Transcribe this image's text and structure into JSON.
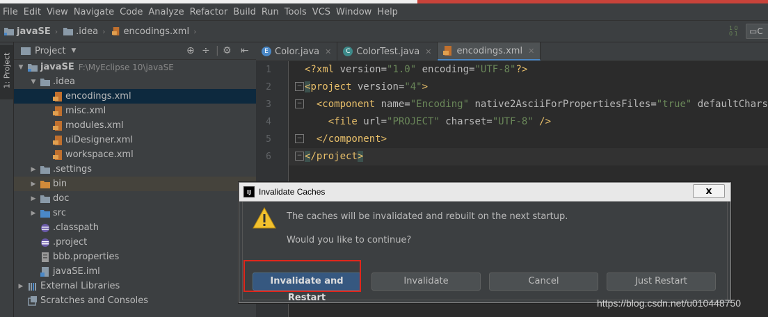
{
  "menu": [
    "File",
    "Edit",
    "View",
    "Navigate",
    "Code",
    "Analyze",
    "Refactor",
    "Build",
    "Run",
    "Tools",
    "VCS",
    "Window",
    "Help"
  ],
  "breadcrumb": [
    "javaSE",
    ".idea",
    "encodings.xml"
  ],
  "toolstrip_label": "1: Project",
  "project_panel": {
    "title": "Project",
    "tree": [
      {
        "label": "javaSE",
        "path": "F:\\MyEclipse 10\\javaSE",
        "icon": "module-folder-icon",
        "arrow": "open",
        "indent": 0
      },
      {
        "label": ".idea",
        "icon": "folder-icon",
        "arrow": "open",
        "indent": 1
      },
      {
        "label": "encodings.xml",
        "icon": "xml-file-icon",
        "arrow": "",
        "indent": 2,
        "selected": true
      },
      {
        "label": "misc.xml",
        "icon": "xml-file-icon",
        "arrow": "",
        "indent": 2
      },
      {
        "label": "modules.xml",
        "icon": "xml-file-icon",
        "arrow": "",
        "indent": 2
      },
      {
        "label": "uiDesigner.xml",
        "icon": "xml-file-icon",
        "arrow": "",
        "indent": 2
      },
      {
        "label": "workspace.xml",
        "icon": "xml-file-icon",
        "arrow": "",
        "indent": 2
      },
      {
        "label": ".settings",
        "icon": "folder-icon",
        "arrow": "closed",
        "indent": 1
      },
      {
        "label": "bin",
        "icon": "folder-orange-icon",
        "arrow": "closed",
        "indent": 1,
        "highlight": true
      },
      {
        "label": "doc",
        "icon": "folder-icon",
        "arrow": "closed",
        "indent": 1
      },
      {
        "label": "src",
        "icon": "folder-blue-icon",
        "arrow": "closed",
        "indent": 1
      },
      {
        "label": ".classpath",
        "icon": "eclipse-file-icon",
        "arrow": "",
        "indent": 1
      },
      {
        "label": ".project",
        "icon": "eclipse-file-icon",
        "arrow": "",
        "indent": 1
      },
      {
        "label": "bbb.properties",
        "icon": "properties-file-icon",
        "arrow": "",
        "indent": 1
      },
      {
        "label": "javaSE.iml",
        "icon": "iml-file-icon",
        "arrow": "",
        "indent": 1
      },
      {
        "label": "External Libraries",
        "icon": "library-icon",
        "arrow": "closed",
        "indent": 0
      },
      {
        "label": "Scratches and Consoles",
        "icon": "scratches-icon",
        "arrow": "",
        "indent": 0
      }
    ]
  },
  "tabs": [
    {
      "label": "Color.java",
      "icon": "enum-icon",
      "active": false
    },
    {
      "label": "ColorTest.java",
      "icon": "class-icon",
      "active": false
    },
    {
      "label": "encodings.xml",
      "icon": "xml-file-icon",
      "active": true
    }
  ],
  "editor": {
    "line_numbers": [
      "1",
      "2",
      "3",
      "4",
      "5",
      "6"
    ]
  },
  "dialog": {
    "title": "Invalidate Caches",
    "close_label": "x",
    "message1": "The caches will be invalidated and rebuilt on the next startup.",
    "message2": "Would you like to continue?",
    "buttons": {
      "invalidate_restart": "Invalidate and Restart",
      "invalidate": "Invalidate",
      "cancel": "Cancel",
      "just_restart": "Just Restart"
    }
  },
  "watermark": "https://blog.csdn.net/u010448750",
  "colors": {
    "accent": "#365880",
    "highlight_box": "#e0261b",
    "selection": "#0d293e"
  }
}
